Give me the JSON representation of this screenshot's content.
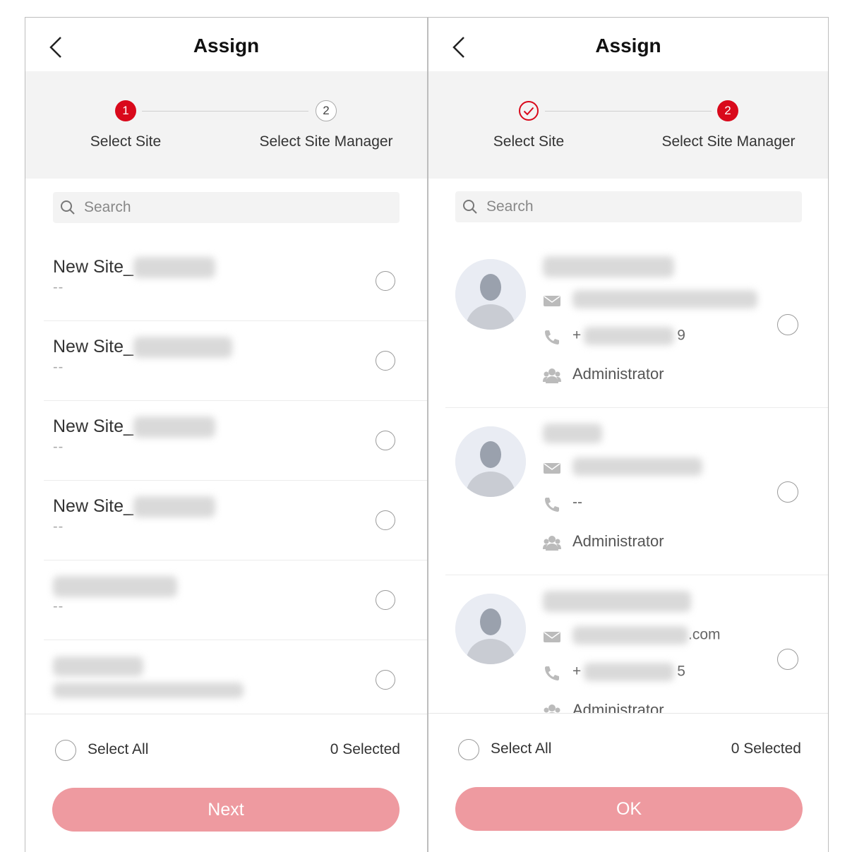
{
  "left_screen": {
    "title": "Assign",
    "steps": [
      {
        "number": "1",
        "label": "Select Site",
        "state": "active"
      },
      {
        "number": "2",
        "label": "Select Site Manager",
        "state": "pending"
      }
    ],
    "search": {
      "placeholder": "Search"
    },
    "sites": [
      {
        "name": "New Site_",
        "sub": "--"
      },
      {
        "name": "New Site_",
        "sub": "--"
      },
      {
        "name": "New Site_",
        "sub": "--"
      },
      {
        "name": "New Site_",
        "sub": "--"
      },
      {
        "name": "",
        "sub": "--"
      },
      {
        "name": "",
        "sub": ""
      }
    ],
    "footer": {
      "select_all": "Select All",
      "selected": "0 Selected",
      "button": "Next"
    }
  },
  "right_screen": {
    "title": "Assign",
    "steps": [
      {
        "number": "",
        "label": "Select Site",
        "state": "done"
      },
      {
        "number": "2",
        "label": "Select Site Manager",
        "state": "active"
      }
    ],
    "search": {
      "placeholder": "Search"
    },
    "users": [
      {
        "email": "",
        "phone_prefix": "+",
        "phone_suffix": "9",
        "role": "Administrator"
      },
      {
        "email": "",
        "phone": "--",
        "role": "Administrator"
      },
      {
        "email_suffix": ".com",
        "phone_prefix": "+",
        "phone_suffix": "5",
        "role": "Administrator"
      }
    ],
    "footer": {
      "select_all": "Select All",
      "selected": "0 Selected",
      "button": "OK"
    }
  },
  "colors": {
    "accent": "#d9091b",
    "button_disabled": "#ee9aa0",
    "stepper_bg": "#f3f3f3"
  },
  "icons": [
    "back-arrow-icon",
    "search-icon",
    "check-circle-icon",
    "mail-icon",
    "phone-icon",
    "role-icon",
    "avatar-icon"
  ]
}
